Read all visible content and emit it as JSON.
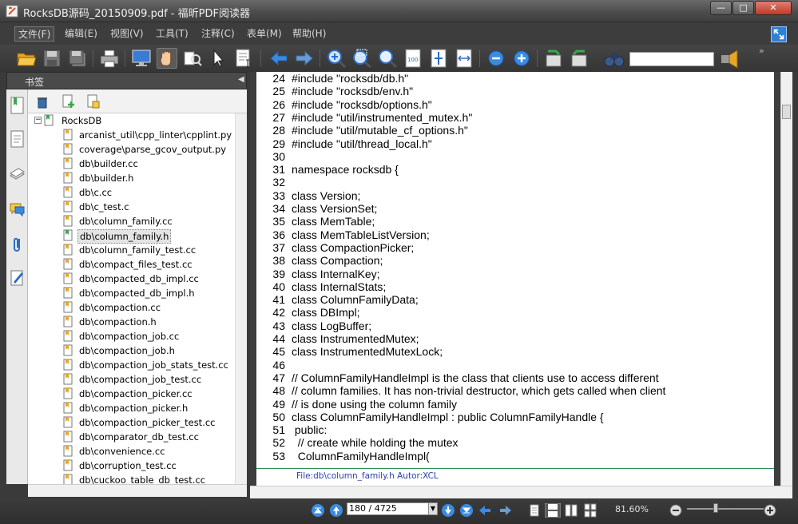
{
  "window": {
    "title": "RocksDB源码_20150909.pdf - 福昕PDF阅读器",
    "min_label": "—",
    "max_label": "□",
    "close_label": "✕"
  },
  "menu": [
    "文件(F)",
    "编辑(E)",
    "视图(V)",
    "工具(T)",
    "注释(C)",
    "表单(M)",
    "帮助(H)"
  ],
  "toolbar": {
    "search_value": "",
    "more_label": "»"
  },
  "bookmarks": {
    "title": "书签",
    "collapse_label": "◀",
    "root": "RocksDB",
    "items": [
      "arcanist_util\\cpp_linter\\cpplint.py",
      "coverage\\parse_gcov_output.py",
      "db\\builder.cc",
      "db\\builder.h",
      "db\\c.cc",
      "db\\c_test.c",
      "db\\column_family.cc",
      "db\\column_family.h",
      "db\\column_family_test.cc",
      "db\\compact_files_test.cc",
      "db\\compacted_db_impl.cc",
      "db\\compacted_db_impl.h",
      "db\\compaction.cc",
      "db\\compaction.h",
      "db\\compaction_job.cc",
      "db\\compaction_job.h",
      "db\\compaction_job_stats_test.cc",
      "db\\compaction_job_test.cc",
      "db\\compaction_picker.cc",
      "db\\compaction_picker.h",
      "db\\compaction_picker_test.cc",
      "db\\comparator_db_test.cc",
      "db\\convenience.cc",
      "db\\corruption_test.cc",
      "db\\cuckoo_table_db_test.cc"
    ],
    "selected_index": 7
  },
  "document": {
    "lines": [
      {
        "n": "24",
        "t": "#include \"rocksdb/db.h\""
      },
      {
        "n": "25",
        "t": "#include \"rocksdb/env.h\""
      },
      {
        "n": "26",
        "t": "#include \"rocksdb/options.h\""
      },
      {
        "n": "27",
        "t": "#include \"util/instrumented_mutex.h\""
      },
      {
        "n": "28",
        "t": "#include \"util/mutable_cf_options.h\""
      },
      {
        "n": "29",
        "t": "#include \"util/thread_local.h\""
      },
      {
        "n": "30",
        "t": ""
      },
      {
        "n": "31",
        "t": "namespace rocksdb {"
      },
      {
        "n": "32",
        "t": ""
      },
      {
        "n": "33",
        "t": "class Version;"
      },
      {
        "n": "34",
        "t": "class VersionSet;"
      },
      {
        "n": "35",
        "t": "class MemTable;"
      },
      {
        "n": "36",
        "t": "class MemTableListVersion;"
      },
      {
        "n": "37",
        "t": "class CompactionPicker;"
      },
      {
        "n": "38",
        "t": "class Compaction;"
      },
      {
        "n": "39",
        "t": "class InternalKey;"
      },
      {
        "n": "40",
        "t": "class InternalStats;"
      },
      {
        "n": "41",
        "t": "class ColumnFamilyData;"
      },
      {
        "n": "42",
        "t": "class DBImpl;"
      },
      {
        "n": "43",
        "t": "class LogBuffer;"
      },
      {
        "n": "44",
        "t": "class InstrumentedMutex;"
      },
      {
        "n": "45",
        "t": "class InstrumentedMutexLock;"
      },
      {
        "n": "46",
        "t": ""
      },
      {
        "n": "47",
        "t": "// ColumnFamilyHandleImpl is the class that clients use to access different"
      },
      {
        "n": "48",
        "t": "// column families. It has non-trivial destructor, which gets called when client"
      },
      {
        "n": "49",
        "t": "// is done using the column family"
      },
      {
        "n": "50",
        "t": "class ColumnFamilyHandleImpl : public ColumnFamilyHandle {"
      },
      {
        "n": "51",
        "t": " public:"
      },
      {
        "n": "52",
        "t": "  // create while holding the mutex"
      },
      {
        "n": "53",
        "t": "  ColumnFamilyHandleImpl("
      }
    ],
    "footer": "File:db\\column_family.h   Autor:XCL"
  },
  "status": {
    "page": "180 / 4725",
    "zoom": "81.60%",
    "zoom_fraction": 0.38
  },
  "colors": {
    "accent": "#2e7fd8",
    "footer_text": "#2a3fa8",
    "footer_rule": "#2e8b57"
  }
}
